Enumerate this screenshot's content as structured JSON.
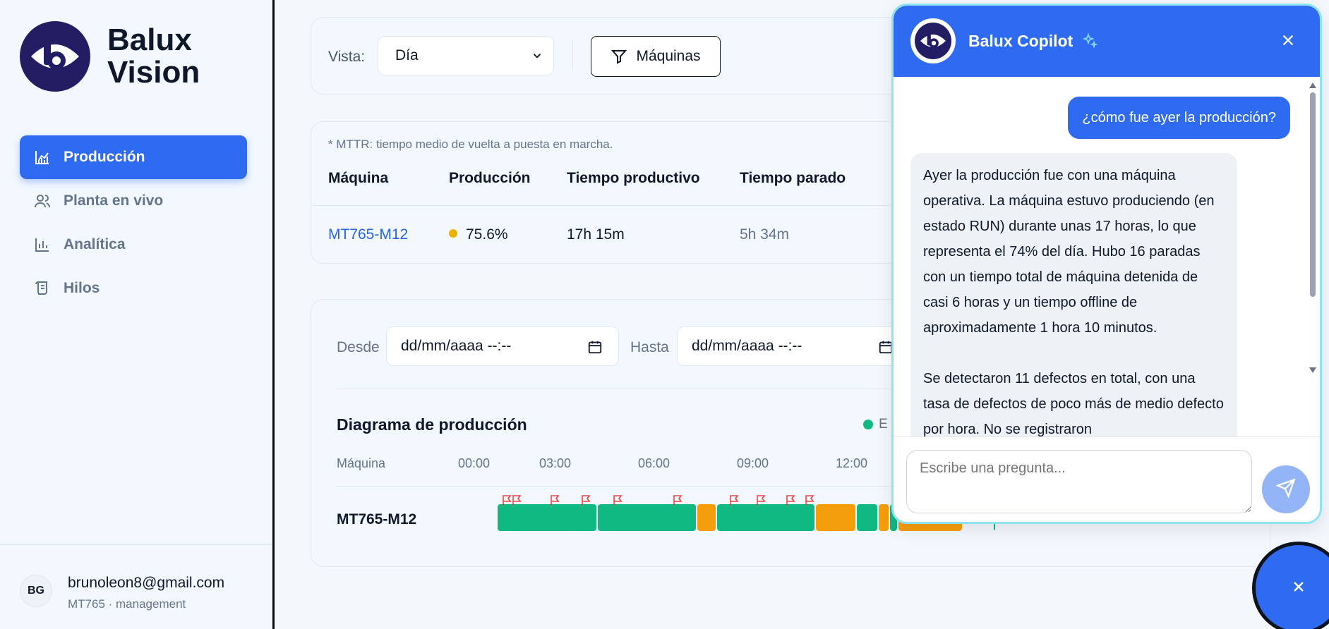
{
  "brand": {
    "name_line1": "Balux",
    "name_line2": "Vision"
  },
  "nav": {
    "items": [
      {
        "label": "Producción",
        "icon": "chart-area-icon",
        "active": true
      },
      {
        "label": "Planta en vivo",
        "icon": "users-icon",
        "active": false
      },
      {
        "label": "Analítica",
        "icon": "bar-chart-icon",
        "active": false
      },
      {
        "label": "Hilos",
        "icon": "scroll-icon",
        "active": false
      }
    ]
  },
  "user": {
    "initials": "BG",
    "email": "brunoleon8@gmail.com",
    "role": "MT765 · management"
  },
  "toolbar": {
    "vista_label": "Vista:",
    "vista_value": "Día",
    "filter_label": "Máquinas"
  },
  "summary": {
    "note": "* MTTR: tiempo medio de vuelta a puesta en marcha.",
    "columns": [
      "Máquina",
      "Producción",
      "Tiempo productivo",
      "Tiempo parado"
    ],
    "rows": [
      {
        "machine": "MT765-M12",
        "production": "75.6%",
        "productive": "17h 15m",
        "stopped": "5h 34m"
      }
    ]
  },
  "diagram": {
    "desde_label": "Desde",
    "hasta_label": "Hasta",
    "date_placeholder": "dd/mm/aaaa --:--",
    "title": "Diagrama de producción",
    "legend_first": "E",
    "machine_col": "Máquina",
    "time_ticks": [
      "00:00",
      "03:00",
      "06:00",
      "09:00",
      "12:00"
    ],
    "machine": "MT765-M12"
  },
  "chat": {
    "title": "Balux Copilot",
    "user_message": "¿cómo fue ayer la producción?",
    "bot_paragraph_1": "Ayer la producción fue con una máquina operativa. La máquina estuvo produciendo (en estado RUN) durante unas 17 horas, lo que representa el 74% del día. Hubo 16 paradas con un tiempo total de máquina detenida de casi 6 horas y un tiempo offline de aproximadamente 1 hora 10 minutos.",
    "bot_paragraph_2": "Se detectaron 11 defectos en total, con una tasa de defectos de poco más de medio defecto por hora. No se registraron",
    "input_placeholder": "Escribe una pregunta..."
  },
  "colors": {
    "primary": "#2f6bf0",
    "run": "#10b981",
    "stop": "#f59e0b",
    "flag": "#ef4444",
    "brand_dark": "#231d63"
  }
}
